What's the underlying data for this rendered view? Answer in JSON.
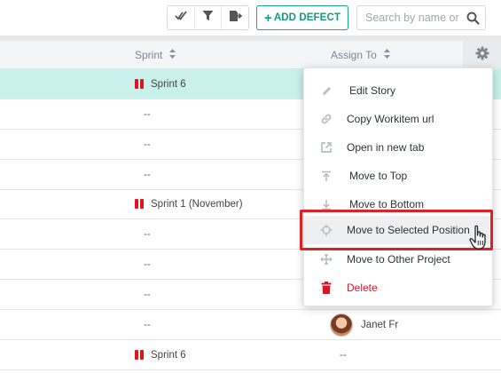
{
  "toolbar": {
    "icons": [
      "check-all-icon",
      "filter-icon",
      "export-icon"
    ],
    "add_defect_label": "ADD DEFECT",
    "search_placeholder": "Search by name or"
  },
  "table": {
    "columns": [
      {
        "label": "Sprint"
      },
      {
        "label": "Assign To"
      }
    ],
    "rows": [
      {
        "sprint": "Sprint 6",
        "has_sprint_icon": true,
        "selected": true,
        "assign": ""
      },
      {
        "sprint": "--",
        "has_sprint_icon": false,
        "assign": ""
      },
      {
        "sprint": "--",
        "has_sprint_icon": false,
        "assign": ""
      },
      {
        "sprint": "--",
        "has_sprint_icon": false,
        "assign": ""
      },
      {
        "sprint": "Sprint 1 (November)",
        "has_sprint_icon": true,
        "assign": ""
      },
      {
        "sprint": "--",
        "has_sprint_icon": false,
        "assign": ""
      },
      {
        "sprint": "--",
        "has_sprint_icon": false,
        "assign": ""
      },
      {
        "sprint": "--",
        "has_sprint_icon": false,
        "assign": ""
      },
      {
        "sprint": "--",
        "has_sprint_icon": false,
        "assign": "Janet Fr"
      },
      {
        "sprint": "Sprint 6",
        "has_sprint_icon": true,
        "assign": "--"
      }
    ]
  },
  "context_menu": {
    "items": [
      {
        "label": "Edit Story",
        "icon": "pencil-icon"
      },
      {
        "label": "Copy Workitem url",
        "icon": "link-icon"
      },
      {
        "label": "Open in new tab",
        "icon": "external-link-icon"
      },
      {
        "label": "Move to Top",
        "icon": "move-top-icon"
      },
      {
        "label": "Move to Bottom",
        "icon": "move-bottom-icon"
      },
      {
        "label": "Move to Selected Position",
        "icon": "crosshair-icon"
      },
      {
        "label": "Move to Other Project",
        "icon": "move-arrows-icon"
      },
      {
        "label": "Delete",
        "icon": "trash-icon"
      }
    ]
  },
  "colors": {
    "accent": "#19a98c",
    "selected_row": "#c9f0ea",
    "sprint_icon": "#e0161b",
    "danger": "#d6172c",
    "highlight": "#e02024"
  }
}
